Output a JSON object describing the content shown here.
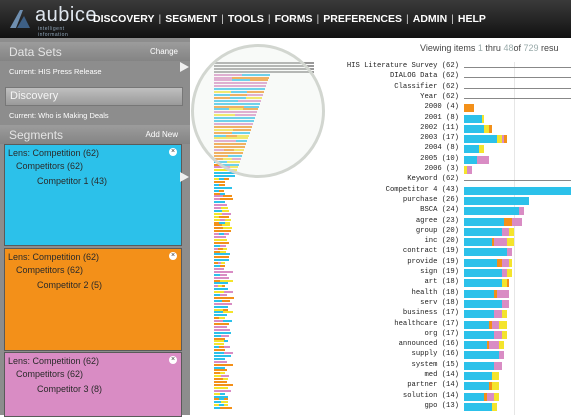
{
  "app": {
    "logo_text": "aubice",
    "logo_tagline": "intelligent information"
  },
  "nav": {
    "items": [
      "DISCOVERY",
      "SEGMENT",
      "TOOLS",
      "FORMS",
      "PREFERENCES",
      "ADMIN",
      "HELP"
    ],
    "separator": "|"
  },
  "left": {
    "datasets_title": "Data Sets",
    "change_link": "Change",
    "datasets_current": "Current:  HIS Press Release",
    "discovery_title": "Discovery",
    "discovery_current": "Current:  Who is Making Deals",
    "segments_title": "Segments",
    "add_new_link": "Add New",
    "segments": [
      {
        "line1": "Lens: Competition (62)",
        "line2": "Competitors (62)",
        "line3": "Competitor 1 (43)",
        "color": "#2cc1ea"
      },
      {
        "line1": "Lens: Competition (62)",
        "line2": "Competitors (62)",
        "line3": "Competitor 2 (5)",
        "color": "#f39019"
      },
      {
        "line1": "Lens: Competition (62)",
        "line2": "Competitors (62)",
        "line3": "Competitor 3 (8)",
        "color": "#d98cc4"
      }
    ],
    "close_glyph": "×"
  },
  "viewing": {
    "prefix": "Viewing items",
    "from": "1",
    "thru_label": "thru",
    "to": "48",
    "of_label": "of",
    "total": "729",
    "suffix": "resu"
  },
  "colors": {
    "cyan": "#2cc1ea",
    "orange": "#f39019",
    "pink": "#d98cc4",
    "yellow": "#f4e42c"
  },
  "rows": [
    {
      "label": "HIS Literature Survey (62)",
      "type": "line"
    },
    {
      "label": "DIALOG Data (62)",
      "type": "line"
    },
    {
      "label": "Classifier (62)",
      "type": "line"
    },
    {
      "label": "Year (62)",
      "type": "line"
    },
    {
      "label": "2000 (4)",
      "segs": [
        [
          "orange",
          4
        ]
      ]
    },
    {
      "label": "2001 (8)",
      "segs": [
        [
          "cyan",
          7
        ],
        [
          "yellow",
          1
        ]
      ]
    },
    {
      "label": "2002 (11)",
      "segs": [
        [
          "cyan",
          8
        ],
        [
          "yellow",
          2
        ],
        [
          "orange",
          1
        ]
      ]
    },
    {
      "label": "2003 (17)",
      "segs": [
        [
          "cyan",
          13
        ],
        [
          "yellow",
          2
        ],
        [
          "pink",
          1
        ],
        [
          "orange",
          1
        ]
      ]
    },
    {
      "label": "2004 (8)",
      "segs": [
        [
          "cyan",
          6
        ],
        [
          "yellow",
          2
        ]
      ]
    },
    {
      "label": "2005 (10)",
      "segs": [
        [
          "cyan",
          5
        ],
        [
          "pink",
          5
        ]
      ]
    },
    {
      "label": "2006 (3)",
      "segs": [
        [
          "yellow",
          1
        ],
        [
          "pink",
          2
        ]
      ]
    },
    {
      "label": "Keyword (62)",
      "type": "line"
    },
    {
      "label": "Competitor 4 (43)",
      "segs": [
        [
          "cyan",
          43
        ]
      ]
    },
    {
      "label": "purchase (26)",
      "segs": [
        [
          "cyan",
          26
        ]
      ]
    },
    {
      "label": "BSCA (24)",
      "segs": [
        [
          "cyan",
          22
        ],
        [
          "pink",
          2
        ]
      ]
    },
    {
      "label": "agree (23)",
      "segs": [
        [
          "cyan",
          16
        ],
        [
          "orange",
          3
        ],
        [
          "pink",
          4
        ]
      ]
    },
    {
      "label": "group (20)",
      "segs": [
        [
          "cyan",
          15
        ],
        [
          "pink",
          3
        ],
        [
          "yellow",
          2
        ]
      ]
    },
    {
      "label": "inc (20)",
      "segs": [
        [
          "cyan",
          11
        ],
        [
          "orange",
          1
        ],
        [
          "pink",
          5
        ],
        [
          "yellow",
          3
        ]
      ]
    },
    {
      "label": "contract (19)",
      "segs": [
        [
          "cyan",
          17
        ],
        [
          "pink",
          2
        ]
      ]
    },
    {
      "label": "provide (19)",
      "segs": [
        [
          "cyan",
          13
        ],
        [
          "orange",
          2
        ],
        [
          "pink",
          3
        ],
        [
          "yellow",
          1
        ]
      ]
    },
    {
      "label": "sign (19)",
      "segs": [
        [
          "cyan",
          15
        ],
        [
          "pink",
          2
        ],
        [
          "yellow",
          2
        ]
      ]
    },
    {
      "label": "art (18)",
      "segs": [
        [
          "cyan",
          15
        ],
        [
          "yellow",
          2
        ],
        [
          "orange",
          1
        ]
      ]
    },
    {
      "label": "health (18)",
      "segs": [
        [
          "cyan",
          12
        ],
        [
          "orange",
          1
        ],
        [
          "pink",
          5
        ]
      ]
    },
    {
      "label": "serv (18)",
      "segs": [
        [
          "cyan",
          15
        ],
        [
          "pink",
          3
        ]
      ]
    },
    {
      "label": "business (17)",
      "segs": [
        [
          "cyan",
          12
        ],
        [
          "pink",
          3
        ],
        [
          "yellow",
          2
        ]
      ]
    },
    {
      "label": "healthcare (17)",
      "segs": [
        [
          "cyan",
          10
        ],
        [
          "orange",
          1
        ],
        [
          "pink",
          3
        ],
        [
          "yellow",
          3
        ]
      ]
    },
    {
      "label": "org (17)",
      "segs": [
        [
          "cyan",
          12
        ],
        [
          "pink",
          3
        ],
        [
          "yellow",
          2
        ]
      ]
    },
    {
      "label": "announced (16)",
      "segs": [
        [
          "cyan",
          9
        ],
        [
          "orange",
          1
        ],
        [
          "pink",
          4
        ],
        [
          "yellow",
          2
        ]
      ]
    },
    {
      "label": "supply (16)",
      "segs": [
        [
          "cyan",
          14
        ],
        [
          "pink",
          2
        ]
      ]
    },
    {
      "label": "system (15)",
      "segs": [
        [
          "cyan",
          12
        ],
        [
          "pink",
          3
        ]
      ]
    },
    {
      "label": "med (14)",
      "segs": [
        [
          "cyan",
          11
        ],
        [
          "yellow",
          3
        ]
      ]
    },
    {
      "label": "partner (14)",
      "segs": [
        [
          "cyan",
          10
        ],
        [
          "orange",
          1
        ],
        [
          "yellow",
          3
        ]
      ]
    },
    {
      "label": "solution (14)",
      "segs": [
        [
          "cyan",
          8
        ],
        [
          "orange",
          1
        ],
        [
          "pink",
          3
        ],
        [
          "yellow",
          2
        ]
      ]
    },
    {
      "label": "gpo (13)",
      "segs": [
        [
          "cyan",
          11
        ],
        [
          "yellow",
          2
        ]
      ]
    }
  ]
}
